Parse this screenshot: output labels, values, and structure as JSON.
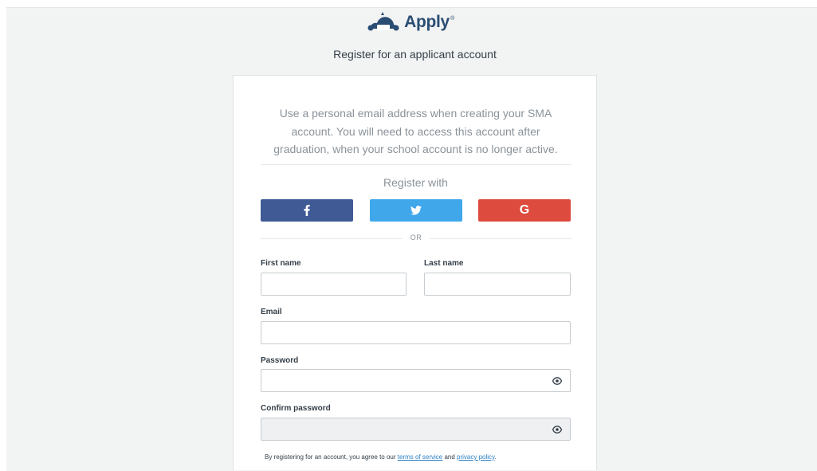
{
  "brand": {
    "name": "Apply",
    "reg_mark": "®"
  },
  "subtitle": "Register for an applicant account",
  "intro": {
    "line1": "Use a personal email address when creating your SMA",
    "line2": "account. You will need to access this account after",
    "line3": "graduation, when your school account is no longer active."
  },
  "social": {
    "heading": "Register with",
    "buttons": [
      {
        "name": "facebook",
        "icon": "facebook-icon",
        "color": "#3f5a95"
      },
      {
        "name": "twitter",
        "icon": "twitter-icon",
        "color": "#3fa7ea"
      },
      {
        "name": "google",
        "icon": "google-icon",
        "label": "G",
        "color": "#dc4b3e"
      }
    ],
    "or_text": "OR"
  },
  "form": {
    "first_name": {
      "label": "First name",
      "value": ""
    },
    "last_name": {
      "label": "Last name",
      "value": ""
    },
    "email": {
      "label": "Email",
      "value": ""
    },
    "password": {
      "label": "Password",
      "value": "",
      "icon": "eye-icon"
    },
    "confirm_password": {
      "label": "Confirm password",
      "value": "",
      "icon": "eye-icon",
      "disabled": true
    }
  },
  "terms": {
    "prefix": "By registering for an account, you agree to our ",
    "terms_link": "terms of service",
    "middle": " and ",
    "privacy_link": "privacy policy",
    "suffix": "."
  },
  "colors": {
    "brand": "#2a4d73",
    "page_background": "#f2f3f3",
    "link": "#2c7fc4"
  }
}
